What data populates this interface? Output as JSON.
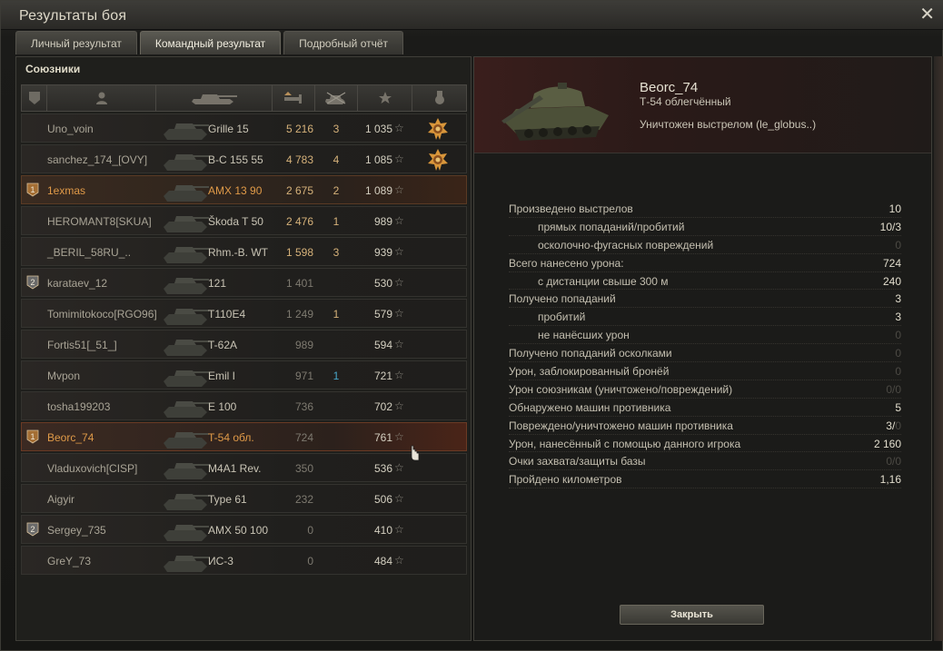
{
  "window": {
    "title": "Результаты боя",
    "close_glyph": "✕"
  },
  "tabs": [
    {
      "label": "Личный результат"
    },
    {
      "label": "Командный результат"
    },
    {
      "label": "Подробный отчёт"
    }
  ],
  "allies_label": "Союзники",
  "header_icons": [
    "rank-icon",
    "player-icon",
    "vehicle-icon",
    "damage-icon",
    "kills-icon",
    "xp-icon",
    "medal-icon"
  ],
  "players": [
    {
      "name": "Uno_voin",
      "vehicle": "Grille 15",
      "damage": "5 216",
      "kills": "3",
      "xp": "1 035",
      "medal": true
    },
    {
      "name": "sanchez_174_[OVY]",
      "vehicle": "B-C 155 55",
      "damage": "4 783",
      "kills": "4",
      "xp": "1 085",
      "medal": true
    },
    {
      "name": "1exmas",
      "vehicle": "AMX 13 90",
      "damage": "2 675",
      "kills": "2",
      "xp": "1 089",
      "badge": "1",
      "me": true
    },
    {
      "name": "HEROMANT8[SKUA]",
      "vehicle": "Škoda T 50",
      "damage": "2 476",
      "kills": "1",
      "xp": "989"
    },
    {
      "name": "_BERIL_58RU_..",
      "vehicle": "Rhm.-B. WT",
      "damage": "1 598",
      "kills": "3",
      "xp": "939"
    },
    {
      "name": "karataev_12",
      "vehicle": "121",
      "damage": "1 401",
      "kills": "",
      "xp": "530",
      "badge": "2"
    },
    {
      "name": "Tomimitokoco[RGO96]",
      "vehicle": "T110E4",
      "damage": "1 249",
      "kills": "1",
      "xp": "579"
    },
    {
      "name": "Fortis51[_51_]",
      "vehicle": "T-62A",
      "damage": "989",
      "kills": "",
      "xp": "594"
    },
    {
      "name": "Mvpon",
      "vehicle": "Emil I",
      "damage": "971",
      "kills": "1",
      "xp": "721",
      "kills_blue": true
    },
    {
      "name": "tosha199203",
      "vehicle": "E 100",
      "damage": "736",
      "kills": "",
      "xp": "702"
    },
    {
      "name": "Beorc_74",
      "vehicle": "T-54 обл.",
      "damage": "724",
      "kills": "",
      "xp": "761",
      "badge": "1",
      "highlight": true
    },
    {
      "name": "Vladuxovich[CISP]",
      "vehicle": "M4A1 Rev.",
      "damage": "350",
      "kills": "",
      "xp": "536"
    },
    {
      "name": "Aigyir",
      "vehicle": "Type 61",
      "damage": "232",
      "kills": "",
      "xp": "506"
    },
    {
      "name": "Sergey_735",
      "vehicle": "AMX 50 100",
      "damage": "0",
      "kills": "",
      "xp": "410",
      "badge": "2"
    },
    {
      "name": "GreY_73",
      "vehicle": "ИС-3",
      "damage": "0",
      "kills": "",
      "xp": "484"
    }
  ],
  "detail": {
    "player": "Beorc_74",
    "tank": "Т-54 облегчённый",
    "status": "Уничтожен выстрелом (le_globus..)"
  },
  "stats": [
    {
      "label": "Произведено выстрелов",
      "value": "10"
    },
    {
      "label": "прямых попаданий/пробитий",
      "value": "10/3",
      "sub": true
    },
    {
      "label": "осколочно-фугасных повреждений",
      "value": "0",
      "sub": true,
      "dim": true
    },
    {
      "label": "Всего нанесено урона:",
      "value": "724"
    },
    {
      "label": "с дистанции свыше 300 м",
      "value": "240",
      "sub": true
    },
    {
      "label": "Получено попаданий",
      "value": "3"
    },
    {
      "label": "пробитий",
      "value": "3",
      "sub": true
    },
    {
      "label": "не нанёсших урон",
      "value": "0",
      "sub": true,
      "dim": true
    },
    {
      "label": "Получено попаданий осколками",
      "value": "0",
      "dim": true
    },
    {
      "label": "Урон, заблокированный бронёй",
      "value": "0",
      "dim": true
    },
    {
      "label": "Урон союзникам (уничтожено/повреждений)",
      "value": "0/0",
      "dim": true
    },
    {
      "label": "Обнаружено машин противника",
      "value": "5"
    },
    {
      "label": "Повреждено/уничтожено машин противника",
      "value": "3/",
      "value_dim": "0"
    },
    {
      "label": "Урон, нанесённый с помощью данного игрока",
      "value": "2 160"
    },
    {
      "label": "Очки захвата/защиты базы",
      "value": "0/0",
      "dim": true
    },
    {
      "label": "Пройдено километров",
      "value": "1,16"
    }
  ],
  "close_button": "Закрыть",
  "star_glyph": "☆"
}
